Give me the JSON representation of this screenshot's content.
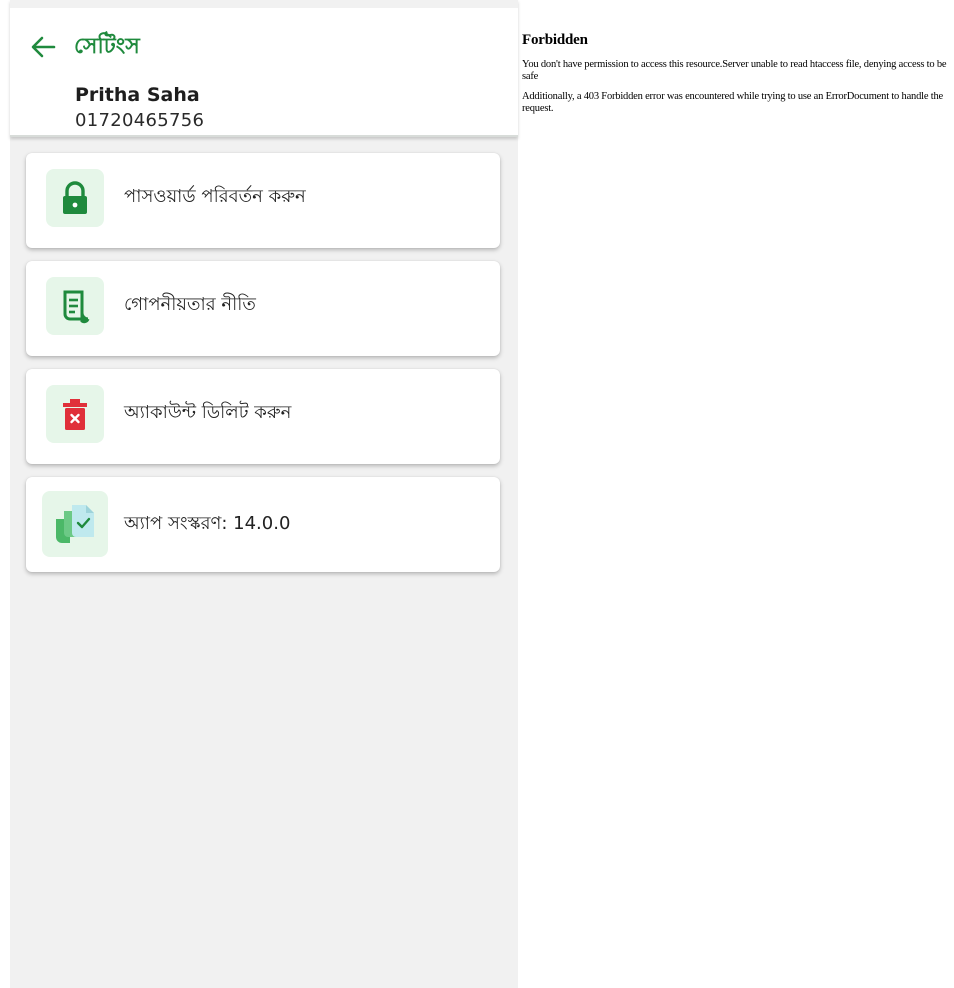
{
  "app": {
    "header": {
      "title": "সেটিংস",
      "back_icon": "arrow-left-icon"
    },
    "user": {
      "name": "Pritha Saha",
      "phone": "01720465756"
    },
    "menu": [
      {
        "label": "পাসওয়ার্ড পরিবর্তন করুন",
        "icon": "lock-icon"
      },
      {
        "label": "গোপনীয়তার নীতি",
        "icon": "document-icon"
      },
      {
        "label": "অ্যাকাউন্ট ডিলিট করুন",
        "icon": "trash-icon"
      },
      {
        "label": "অ্যাপ সংস্করণ: 14.0.0",
        "icon": "app-version-icon"
      }
    ],
    "colors": {
      "accent": "#1f8a3d",
      "icon_bg": "#e6f6e9",
      "danger": "#e0303a",
      "background": "#f1f1f1"
    }
  },
  "error_page": {
    "title": "Forbidden",
    "paragraphs": [
      "You don't have permission to access this resource.Server unable to read htaccess file, denying access to be safe",
      "Additionally, a 403 Forbidden error was encountered while trying to use an ErrorDocument to handle the request."
    ]
  }
}
